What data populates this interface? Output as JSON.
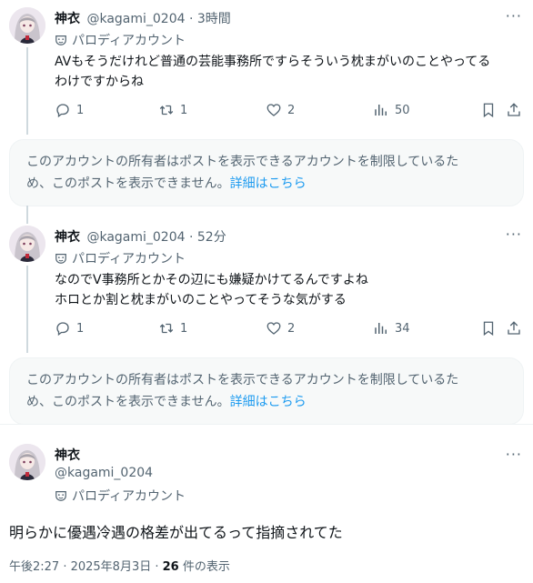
{
  "tweets": [
    {
      "name": "神衣",
      "handle": "@kagami_0204",
      "separator": "·",
      "time": "3時間",
      "badge": "パロディアカウント",
      "text": "AVもそうだけれど普通の芸能事務所ですらそういう枕まがいのことやってる\nわけですからね",
      "replies": "1",
      "reposts": "1",
      "likes": "2",
      "views": "50"
    },
    {
      "name": "神衣",
      "handle": "@kagami_0204",
      "separator": "·",
      "time": "52分",
      "badge": "パロディアカウント",
      "text": "なのでV事務所とかその辺にも嫌疑かけてるんですよね\nホロとか割と枕まがいのことやってそうな気がする",
      "replies": "1",
      "reposts": "1",
      "likes": "2",
      "views": "34"
    }
  ],
  "notice": {
    "text": "このアカウントの所有者はポストを表示できるアカウントを制限しているた\nめ、このポストを表示できません。",
    "link": "詳細はこちら"
  },
  "main": {
    "name": "神衣",
    "handle": "@kagami_0204",
    "badge": "パロディアカウント",
    "text": "明らかに優遇冷遇の格差が出てるって指摘されてた",
    "timestamp": "午後2:27 · 2025年8月3日 · ",
    "views_count": "26",
    "views_label": " 件の表示"
  },
  "more_label": "···",
  "icons": [
    "reply-icon",
    "repost-icon",
    "like-icon",
    "views-icon",
    "bookmark-icon",
    "share-icon",
    "parody-mask-icon",
    "more-icon"
  ],
  "colors": {
    "link": "#1d9bf0",
    "muted": "#536471",
    "text": "#0f1419",
    "notice_bg": "#f7f9f9"
  }
}
